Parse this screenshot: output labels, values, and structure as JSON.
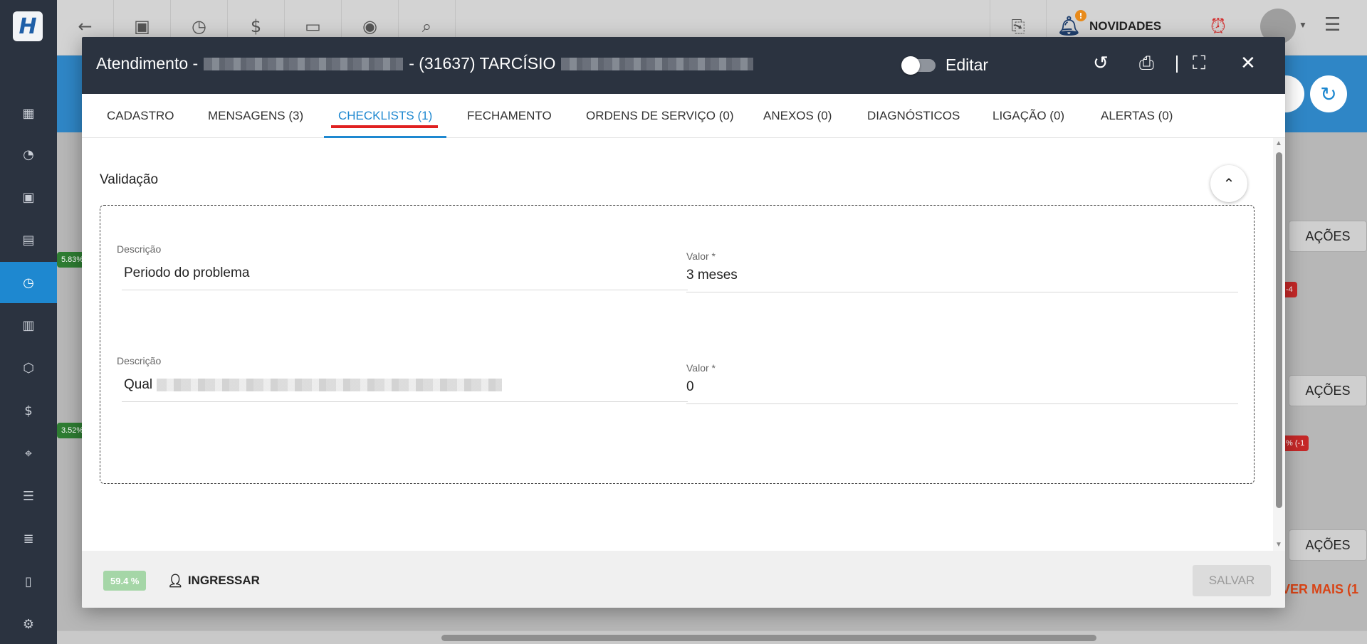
{
  "topbar": {
    "news_label": "NOVIDADES",
    "news_badge": "!"
  },
  "background": {
    "acoes_label": "AÇÕES",
    "ver_mais_label": "VER MAIS (1",
    "pills": [
      "5.83%",
      "3.52%",
      "-4",
      "% (-1"
    ]
  },
  "modal": {
    "title_prefix": "Atendimento -",
    "title_middle": "- (31637) TARCÍSIO",
    "edit_label": "Editar",
    "tabs": [
      {
        "label": "CADASTRO"
      },
      {
        "label": "MENSAGENS (3)"
      },
      {
        "label": "CHECKLISTS (1)"
      },
      {
        "label": "FECHAMENTO"
      },
      {
        "label": "ORDENS DE SERVIÇO (0)"
      },
      {
        "label": "ANEXOS (0)"
      },
      {
        "label": "DIAGNÓSTICOS"
      },
      {
        "label": "LIGAÇÃO (0)"
      },
      {
        "label": "ALERTAS (0)"
      }
    ],
    "section_title": "Validação",
    "items": [
      {
        "desc_label": "Descrição",
        "desc_value": "Periodo do problema",
        "value_label": "Valor *",
        "value": "3 meses"
      },
      {
        "desc_label": "Descrição",
        "desc_value": "Qual",
        "value_label": "Valor *",
        "value": "0"
      }
    ],
    "footer": {
      "progress": "59.4 %",
      "join_label": "INGRESSAR",
      "save_label": "SALVAR"
    }
  }
}
